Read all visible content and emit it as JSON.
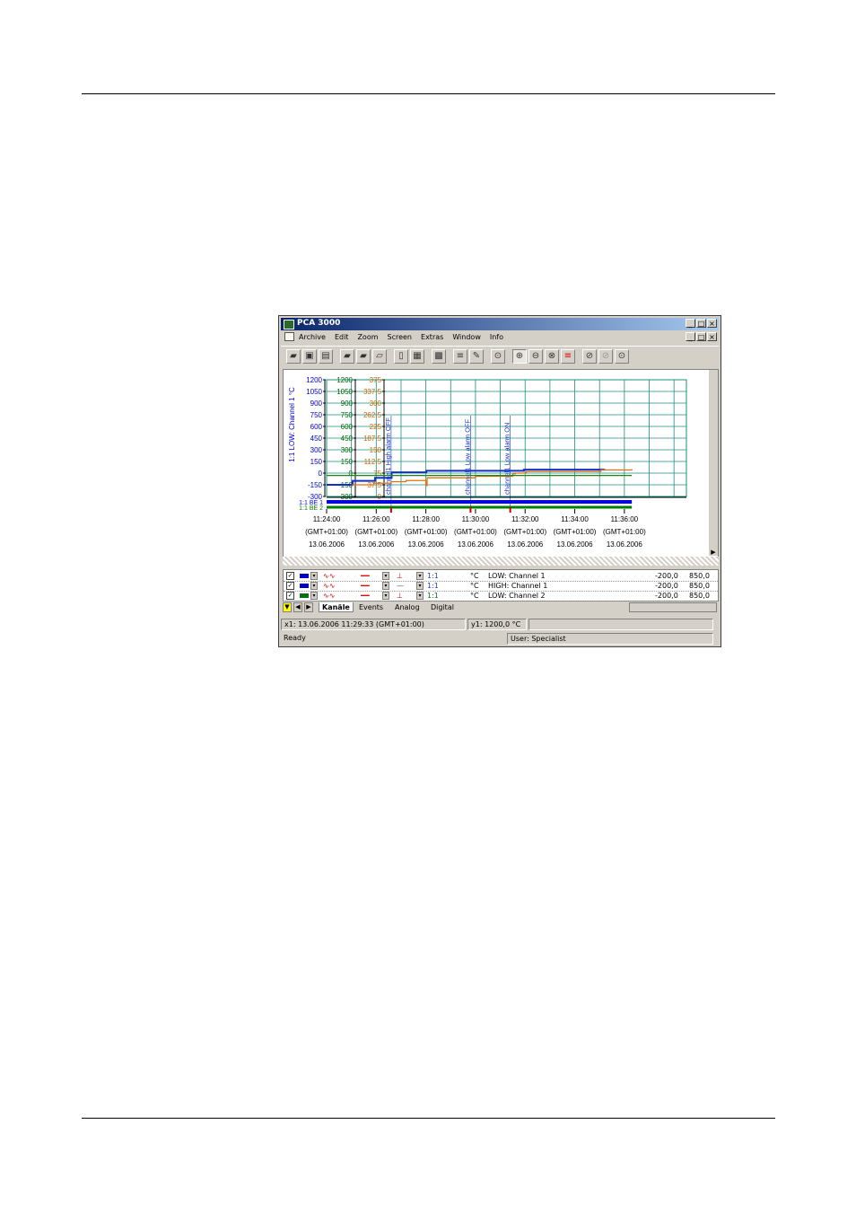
{
  "window": {
    "title": "PCA 3000",
    "controls": [
      "_",
      "□",
      "×"
    ]
  },
  "menu": {
    "items": [
      "Archive",
      "Edit",
      "Zoom",
      "Screen",
      "Extras",
      "Window",
      "Info"
    ]
  },
  "chart_data": {
    "type": "line",
    "y_axes": [
      {
        "label": "1:1 LOW: Channel 1 °C",
        "color": "#0000cc",
        "ticks": [
          "1200",
          "1050",
          "900",
          "750",
          "600",
          "450",
          "300",
          "150",
          "0",
          "-150",
          "-300"
        ]
      },
      {
        "label": "",
        "color": "#006600",
        "ticks": [
          "1200",
          "1050",
          "900",
          "750",
          "600",
          "450",
          "300",
          "150",
          "0",
          "-150",
          "-300"
        ]
      },
      {
        "label": "",
        "color": "#cc6600",
        "ticks": [
          "375",
          "337.5",
          "300",
          "262.5",
          "225",
          "187.5",
          "150",
          "112.5",
          "75",
          "37.5",
          "0"
        ]
      }
    ],
    "x_ticks": [
      {
        "time": "11:24:00",
        "tz": "(GMT+01:00)",
        "date": "13.06.2006"
      },
      {
        "time": "11:26:00",
        "tz": "(GMT+01:00)",
        "date": "13.06.2006"
      },
      {
        "time": "11:28:00",
        "tz": "(GMT+01:00)",
        "date": "13.06.2006"
      },
      {
        "time": "11:30:00",
        "tz": "(GMT+01:00)",
        "date": "13.06.2006"
      },
      {
        "time": "11:32:00",
        "tz": "(GMT+01:00)",
        "date": "13.06.2006"
      },
      {
        "time": "11:34:00",
        "tz": "(GMT+01:00)",
        "date": "13.06.2006"
      },
      {
        "time": "11:36:00",
        "tz": "(GMT+01:00)",
        "date": "13.06.2006"
      }
    ],
    "x_range_min": [
      0,
      14.5
    ],
    "annotations": [
      {
        "text": "channel1 High alarm OFF",
        "x_min": 2.6
      },
      {
        "text": "channel1 Low alarm OFF",
        "x_min": 5.8
      },
      {
        "text": "channel1 Low alarm ON",
        "x_min": 7.4
      }
    ],
    "series": [
      {
        "name": "LOW: Channel 1",
        "color": "#1030c8",
        "x_min": [
          0,
          1.0,
          1.05,
          1.9,
          1.95,
          2.6,
          2.62,
          4.0,
          4.02,
          7.9,
          7.95,
          11.0,
          11.2
        ],
        "values": [
          -150,
          -150,
          -100,
          -100,
          -60,
          -60,
          10,
          10,
          30,
          30,
          45,
          45,
          50
        ]
      },
      {
        "name": "HIGH: Channel 1",
        "color": "#e07010",
        "x_min": [
          1.0,
          1.9,
          2.6,
          3.2,
          3.9,
          4.0,
          4.05,
          6.0,
          7.5,
          7.6,
          8.0,
          8.05,
          11.0,
          11.05,
          12.3
        ],
        "values": [
          -150,
          -130,
          -110,
          -95,
          -95,
          -160,
          -60,
          -40,
          -10,
          0,
          0,
          20,
          20,
          40,
          50
        ]
      },
      {
        "name": "LOW: Channel 2",
        "color": "#138a13",
        "x_min": [
          0,
          12.3
        ],
        "values": [
          -30,
          -30
        ]
      }
    ],
    "digital_lanes": [
      {
        "label": "1:1 BE 1",
        "color": "#0000ff"
      },
      {
        "label": "1:1 BE 2",
        "color": "#008000"
      }
    ]
  },
  "channels": [
    {
      "checked": true,
      "color": "#0000c0",
      "ratio": "1:1",
      "unit": "°C",
      "name": "LOW: Channel 1",
      "min": "-200,0",
      "max": "850,0"
    },
    {
      "checked": true,
      "color": "#0000c0",
      "ratio": "1:1",
      "unit": "°C",
      "name": "HIGH: Channel 1",
      "min": "-200,0",
      "max": "850,0"
    },
    {
      "checked": true,
      "color": "#107010",
      "ratio": "1:1",
      "unit": "°C",
      "name": "LOW: Channel 2",
      "min": "-200,0",
      "max": "850,0"
    }
  ],
  "tabs": [
    "Kanäle",
    "Events",
    "Analog",
    "Digital"
  ],
  "status": {
    "x1": "x1: 13.06.2006 11:29:33 (GMT+01:00)",
    "y1": "y1: 1200,0 °C",
    "ready": "Ready",
    "user": "User: Specialist"
  }
}
